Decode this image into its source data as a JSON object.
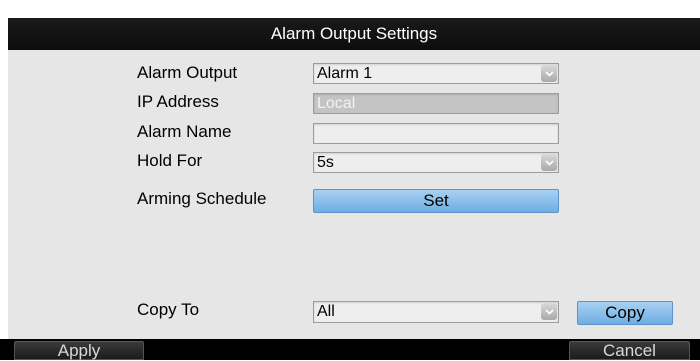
{
  "dialog": {
    "title": "Alarm Output Settings"
  },
  "form": {
    "alarm_output": {
      "label": "Alarm Output",
      "value": "Alarm 1"
    },
    "ip_address": {
      "label": "IP Address",
      "value": "Local"
    },
    "alarm_name": {
      "label": "Alarm Name",
      "value": ""
    },
    "hold_for": {
      "label": "Hold For",
      "value": "5s"
    },
    "arming_schedule": {
      "label": "Arming Schedule",
      "button_label": "Set"
    },
    "copy_to": {
      "label": "Copy To",
      "value": "All",
      "button_label": "Copy"
    }
  },
  "footer": {
    "apply_label": "Apply",
    "cancel_label": "Cancel"
  },
  "icons": {
    "dropdown": "chevron-down-icon"
  },
  "colors": {
    "titlebar": "#111111",
    "dialog_bg": "#e6e6e6",
    "button_blue": "#8cc0ea",
    "footer_bg": "#000000"
  }
}
